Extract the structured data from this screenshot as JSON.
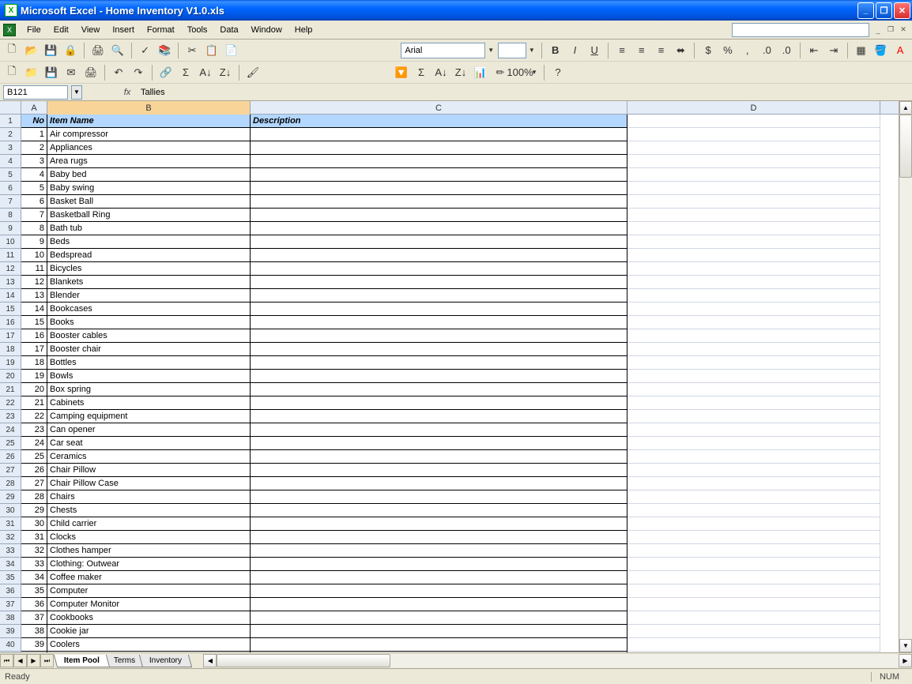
{
  "titleBar": {
    "appName": "Microsoft Excel",
    "docName": "Home Inventory V1.0.xls"
  },
  "menu": [
    "File",
    "Edit",
    "View",
    "Insert",
    "Format",
    "Tools",
    "Data",
    "Window",
    "Help"
  ],
  "toolbar": {
    "fontName": "Arial",
    "fontSize": ""
  },
  "formulaBar": {
    "nameBox": "B121",
    "formula": "Tallies"
  },
  "columns": [
    "A",
    "B",
    "C",
    "D"
  ],
  "headers": {
    "no": "No",
    "itemName": "Item Name",
    "description": "Description"
  },
  "rows": [
    {
      "n": 1,
      "name": "Air compressor"
    },
    {
      "n": 2,
      "name": "Appliances"
    },
    {
      "n": 3,
      "name": "Area rugs"
    },
    {
      "n": 4,
      "name": "Baby bed"
    },
    {
      "n": 5,
      "name": "Baby swing"
    },
    {
      "n": 6,
      "name": "Basket Ball"
    },
    {
      "n": 7,
      "name": "Basketball Ring"
    },
    {
      "n": 8,
      "name": "Bath tub"
    },
    {
      "n": 9,
      "name": "Beds"
    },
    {
      "n": 10,
      "name": "Bedspread"
    },
    {
      "n": 11,
      "name": "Bicycles"
    },
    {
      "n": 12,
      "name": "Blankets"
    },
    {
      "n": 13,
      "name": "Blender"
    },
    {
      "n": 14,
      "name": "Bookcases"
    },
    {
      "n": 15,
      "name": "Books"
    },
    {
      "n": 16,
      "name": "Booster cables"
    },
    {
      "n": 17,
      "name": "Booster chair"
    },
    {
      "n": 18,
      "name": "Bottles"
    },
    {
      "n": 19,
      "name": "Bowls"
    },
    {
      "n": 20,
      "name": "Box spring"
    },
    {
      "n": 21,
      "name": "Cabinets"
    },
    {
      "n": 22,
      "name": "Camping equipment"
    },
    {
      "n": 23,
      "name": "Can opener"
    },
    {
      "n": 24,
      "name": "Car seat"
    },
    {
      "n": 25,
      "name": "Ceramics"
    },
    {
      "n": 26,
      "name": "Chair Pillow"
    },
    {
      "n": 27,
      "name": "Chair Pillow Case"
    },
    {
      "n": 28,
      "name": "Chairs"
    },
    {
      "n": 29,
      "name": "Chests"
    },
    {
      "n": 30,
      "name": "Child carrier"
    },
    {
      "n": 31,
      "name": "Clocks"
    },
    {
      "n": 32,
      "name": "Clothes hamper"
    },
    {
      "n": 33,
      "name": "Clothing: Outwear"
    },
    {
      "n": 34,
      "name": "Coffee maker"
    },
    {
      "n": 35,
      "name": "Computer"
    },
    {
      "n": 36,
      "name": "Computer Monitor"
    },
    {
      "n": 37,
      "name": "Cookbooks"
    },
    {
      "n": 38,
      "name": "Cookie jar"
    },
    {
      "n": 39,
      "name": "Coolers"
    }
  ],
  "tabs": [
    {
      "label": "Item Pool",
      "active": true
    },
    {
      "label": "Terms",
      "active": false
    },
    {
      "label": "Inventory",
      "active": false
    }
  ],
  "status": {
    "text": "Ready",
    "indicator": "NUM"
  }
}
